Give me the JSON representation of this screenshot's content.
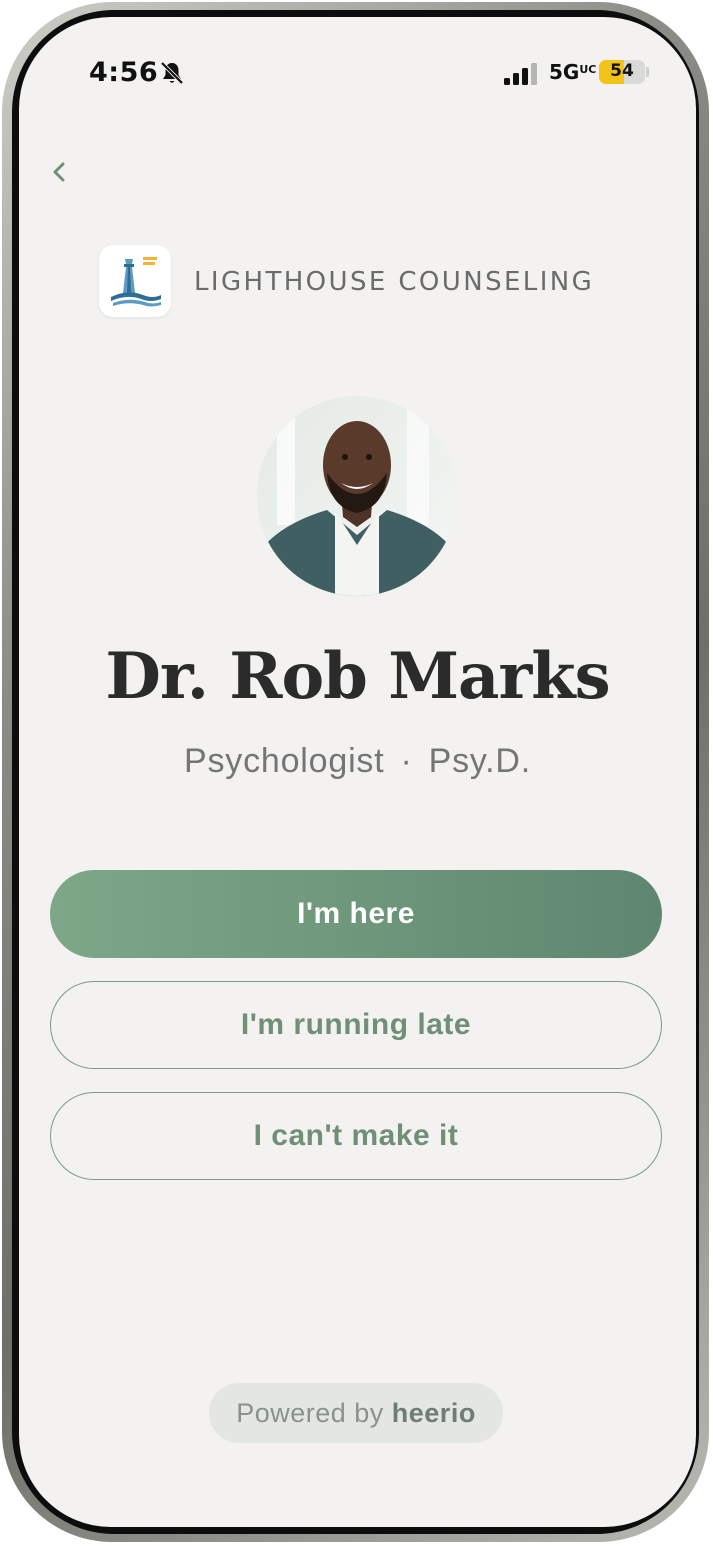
{
  "status_bar": {
    "time": "4:56",
    "network": "5G",
    "network_suffix": "UC",
    "battery_level": "54",
    "battery_percent": 54,
    "battery_color": "#f2c318"
  },
  "header": {
    "back_icon": "chevron-left-icon",
    "brand_name": "LIGHTHOUSE COUNSELING",
    "brand_logo_icon": "lighthouse-logo-icon"
  },
  "provider": {
    "name": "Dr. Rob Marks",
    "title": "Psychologist",
    "separator": "·",
    "credential": "Psy.D."
  },
  "actions": {
    "here_label": "I'm here",
    "late_label": "I'm running late",
    "cant_label": "I can't make it"
  },
  "footer": {
    "powered_prefix": "Powered by",
    "powered_brand": "heerio"
  },
  "colors": {
    "accent": "#6d957a",
    "background": "#f3f2f0",
    "outline": "#7a9a84"
  }
}
